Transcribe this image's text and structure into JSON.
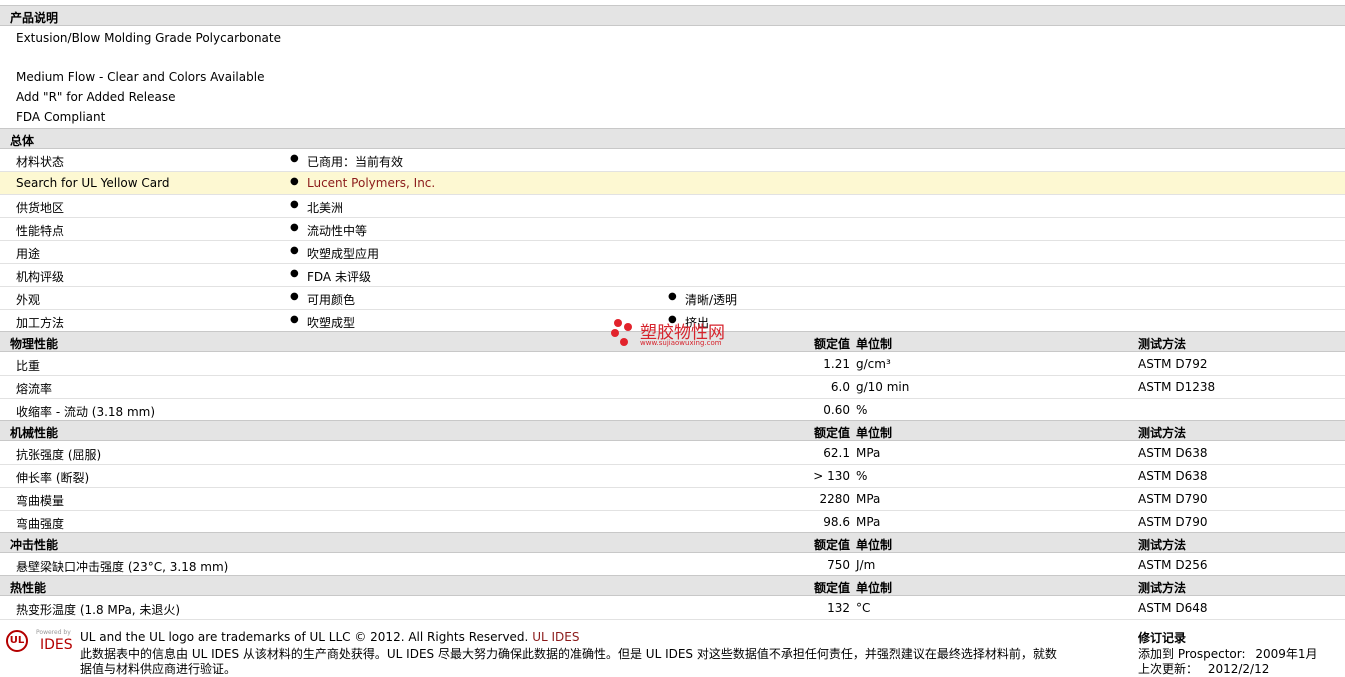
{
  "sections": {
    "desc": "产品说明",
    "general": "总体",
    "physical": "物理性能",
    "mechanical": "机械性能",
    "impact": "冲击性能",
    "thermal": "热性能"
  },
  "col_headers": {
    "value": "额定值",
    "unit": "单位制",
    "method": "测试方法"
  },
  "description": [
    "Extusion/Blow Molding Grade Polycarbonate",
    "Medium Flow - Clear and Colors Available",
    "Add \"R\" for Added Release",
    "FDA Compliant"
  ],
  "general_rows": [
    {
      "label": "材料状态",
      "v1": "已商用：当前有效",
      "v2": ""
    },
    {
      "label": "Search for UL Yellow Card",
      "v1": "Lucent Polymers, Inc.",
      "v2": ""
    },
    {
      "label": "供货地区",
      "v1": "北美洲",
      "v2": ""
    },
    {
      "label": "性能特点",
      "v1": "流动性中等",
      "v2": ""
    },
    {
      "label": "用途",
      "v1": "吹塑成型应用",
      "v2": ""
    },
    {
      "label": "机构评级",
      "v1": "FDA 未评级",
      "v2": ""
    },
    {
      "label": "外观",
      "v1": "可用颜色",
      "v2": "清晰/透明"
    },
    {
      "label": "加工方法",
      "v1": "吹塑成型",
      "v2": "挤出"
    }
  ],
  "physical_rows": [
    {
      "label": "比重",
      "value": "1.21",
      "unit": "g/cm³",
      "method": "ASTM D792"
    },
    {
      "label": "熔流率",
      "value": "6.0",
      "unit": "g/10 min",
      "method": "ASTM D1238"
    },
    {
      "label": "收缩率  - 流动  (3.18 mm)",
      "value": "0.60",
      "unit": "%",
      "method": ""
    }
  ],
  "mechanical_rows": [
    {
      "label": "抗张强度  (屈服)",
      "value": "62.1",
      "unit": "MPa",
      "method": "ASTM D638"
    },
    {
      "label": "伸长率  (断裂)",
      "value": "> 130",
      "unit": "%",
      "method": "ASTM D638"
    },
    {
      "label": "弯曲模量",
      "value": "2280",
      "unit": "MPa",
      "method": "ASTM D790"
    },
    {
      "label": "弯曲强度",
      "value": "98.6",
      "unit": "MPa",
      "method": "ASTM D790"
    }
  ],
  "impact_rows": [
    {
      "label": "悬壁梁缺口冲击强度  (23°C, 3.18 mm)",
      "value": "750",
      "unit": "J/m",
      "method": "ASTM D256"
    }
  ],
  "thermal_rows": [
    {
      "label": "热变形温度  (1.8 MPa, 未退火)",
      "value": "132",
      "unit": "°C",
      "method": "ASTM D648"
    }
  ],
  "watermark": {
    "title": "塑胶物性网",
    "url": "www.sujiaowuxing.com"
  },
  "footer": {
    "powered": "Powered by",
    "ul": "UL",
    "ides": "IDES",
    "trademark": "UL and the UL logo are trademarks of UL LLC © 2012. All Rights Reserved.",
    "ul_ides_link": "UL IDES",
    "disclaimer1": "此数据表中的信息由  UL IDES 从该材料的生产商处获得。UL IDES 尽最大努力确保此数据的准确性。但是  UL IDES 对这些数据值不承担任何责任，并强烈建议在最终选择材料前，就数",
    "disclaimer2": "据值与材料供应商进行验证。",
    "revision_title": "修订记录",
    "added_label": "添加到  Prospector:",
    "added_date": "2009年1月",
    "updated_label": "上次更新：",
    "updated_date": "2012/2/12"
  },
  "colors": {
    "section_bg": "#e4e4e4",
    "highlight_bg": "#fdf8d2",
    "link": "#8b1a1a",
    "brand_red": "#b40000"
  }
}
